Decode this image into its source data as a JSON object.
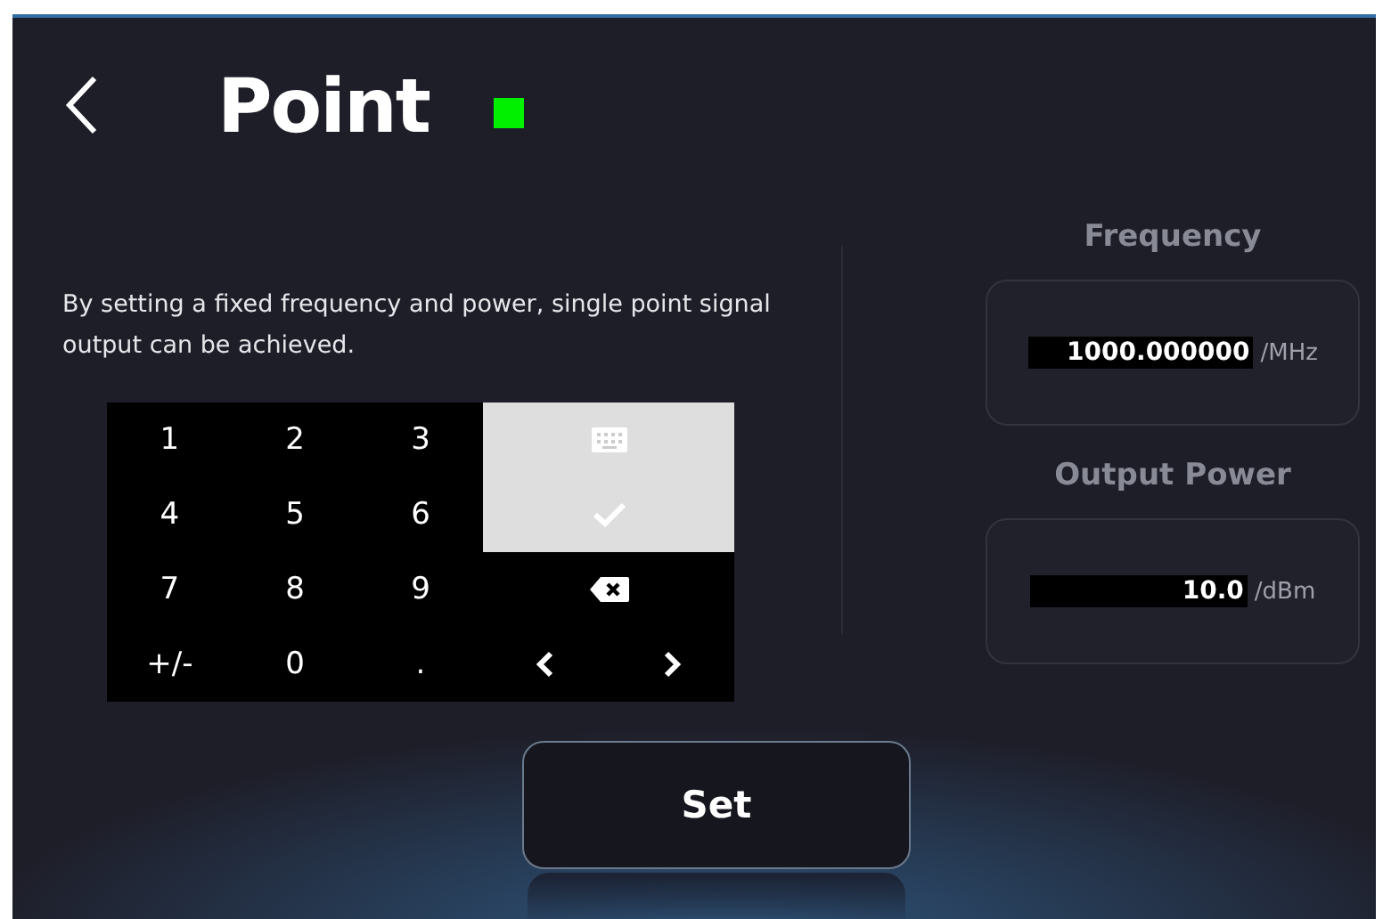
{
  "header": {
    "title": "Point",
    "output_on": true
  },
  "description": "By setting a fixed frequency and power, single point signal output can be achieved.",
  "keypad": [
    {
      "kind": "char",
      "label": "1"
    },
    {
      "kind": "char",
      "label": "2"
    },
    {
      "kind": "char",
      "label": "3"
    },
    {
      "kind": "keyboard"
    },
    {
      "kind": "char",
      "label": "4"
    },
    {
      "kind": "char",
      "label": "5"
    },
    {
      "kind": "char",
      "label": "6"
    },
    {
      "kind": "confirm"
    },
    {
      "kind": "char",
      "label": "7"
    },
    {
      "kind": "char",
      "label": "8"
    },
    {
      "kind": "char",
      "label": "9"
    },
    {
      "kind": "backspace"
    },
    {
      "kind": "char",
      "label": "+/-"
    },
    {
      "kind": "char",
      "label": "0"
    },
    {
      "kind": "char",
      "label": "."
    },
    {
      "kind": "left"
    },
    {
      "kind": "right"
    }
  ],
  "fields": [
    {
      "label": "Frequency",
      "value": "1000.000000",
      "unit": "/MHz"
    },
    {
      "label": "Output Power",
      "value": "10.0",
      "unit": "/dBm"
    }
  ],
  "set_button": "Set"
}
